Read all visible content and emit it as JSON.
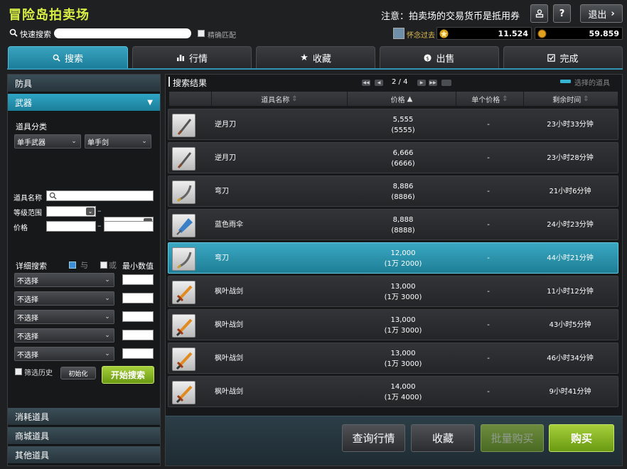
{
  "header": {
    "title": "冒险岛拍卖场",
    "notice": "注意：拍卖场的交易货币是抵用券",
    "exit_label": "退出",
    "help_label": "?"
  },
  "quick_search": {
    "label": "快速搜索",
    "value": "",
    "fuzzy_label": "精确匹配"
  },
  "user": {
    "name": "怀念过去",
    "currency1": "11.524",
    "currency2": "59.859"
  },
  "tabs": [
    {
      "label": "搜索",
      "icon": "search"
    },
    {
      "label": "行情",
      "icon": "chart"
    },
    {
      "label": "收藏",
      "icon": "star"
    },
    {
      "label": "出售",
      "icon": "coin"
    },
    {
      "label": "完成",
      "icon": "check"
    }
  ],
  "sidebar": {
    "categories_top": [
      "防具",
      "武器"
    ],
    "item_class_label": "道具分类",
    "class_select": "单手武器",
    "subclass_select": "单手剑",
    "name_label": "道具名称",
    "level_label": "等级范围",
    "price_label": "价格",
    "detail_label": "详细搜索",
    "and_label": "与",
    "or_label": "或",
    "min_label": "最小数值",
    "detail_selects": [
      "不选择",
      "不选择",
      "不选择",
      "不选择",
      "不选择"
    ],
    "history_label": "筛选历史",
    "reset_label": "初始化",
    "search_label": "开始搜索",
    "categories_bottom": [
      "消耗道具",
      "商城道具",
      "其他道具"
    ]
  },
  "results": {
    "title": "搜索结果",
    "page": "2 / 4",
    "selected_label": "选择的道具",
    "columns": [
      "道具名称",
      "价格",
      "单个价格",
      "剩余时间"
    ],
    "rows": [
      {
        "name": "逆月刀",
        "price": "5,555",
        "price2": "(5555)",
        "unit": "-",
        "time": "23小时33分钟",
        "icon": "knife-icon"
      },
      {
        "name": "逆月刀",
        "price": "6,666",
        "price2": "(6666)",
        "unit": "-",
        "time": "23小时28分钟",
        "icon": "knife-icon"
      },
      {
        "name": "弯刀",
        "price": "8,886",
        "price2": "(8886)",
        "unit": "-",
        "time": "21小时6分钟",
        "icon": "scimitar-icon"
      },
      {
        "name": "蓝色雨伞",
        "price": "8,888",
        "price2": "(8888)",
        "unit": "-",
        "time": "24小时23分钟",
        "icon": "umbrella-icon"
      },
      {
        "name": "弯刀",
        "price": "12,000",
        "price2": "(1万 2000)",
        "unit": "-",
        "time": "44小时21分钟",
        "icon": "scimitar-icon",
        "selected": true
      },
      {
        "name": "枫叶战剑",
        "price": "13,000",
        "price2": "(1万 3000)",
        "unit": "-",
        "time": "11小时12分钟",
        "icon": "maple-sword-icon"
      },
      {
        "name": "枫叶战剑",
        "price": "13,000",
        "price2": "(1万 3000)",
        "unit": "-",
        "time": "43小时5分钟",
        "icon": "maple-sword-icon"
      },
      {
        "name": "枫叶战剑",
        "price": "13,000",
        "price2": "(1万 3000)",
        "unit": "-",
        "time": "46小时34分钟",
        "icon": "maple-sword-icon"
      },
      {
        "name": "枫叶战剑",
        "price": "14,000",
        "price2": "(1万 4000)",
        "unit": "-",
        "time": "9小时41分钟",
        "icon": "maple-sword-icon"
      }
    ]
  },
  "actions": {
    "market": "查询行情",
    "favorite": "收藏",
    "bulk_buy": "批量购买",
    "buy": "购买"
  }
}
